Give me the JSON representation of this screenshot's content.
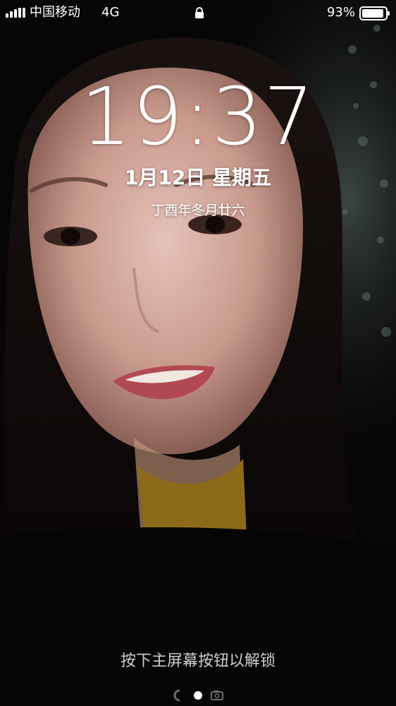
{
  "status_bar": {
    "carrier": "中国移动",
    "network": "4G",
    "battery_percent": "93%",
    "battery_level": 0.93,
    "icons": [
      "signal-icon",
      "lock-icon",
      "battery-icon"
    ]
  },
  "lock_screen": {
    "time": "19:37",
    "date": "1月12日 星期五",
    "lunar_date": "丁酉年冬月廿六",
    "unlock_hint": "按下主屏幕按钮以解锁",
    "pages": [
      "camera-page",
      "notifications-page",
      "camera-icon"
    ],
    "current_page": 1
  },
  "colors": {
    "text": "#ffffff",
    "hint": "#cfcfcf",
    "active_dot": "#ffffff",
    "inactive_dot": "#6e6e6e"
  }
}
